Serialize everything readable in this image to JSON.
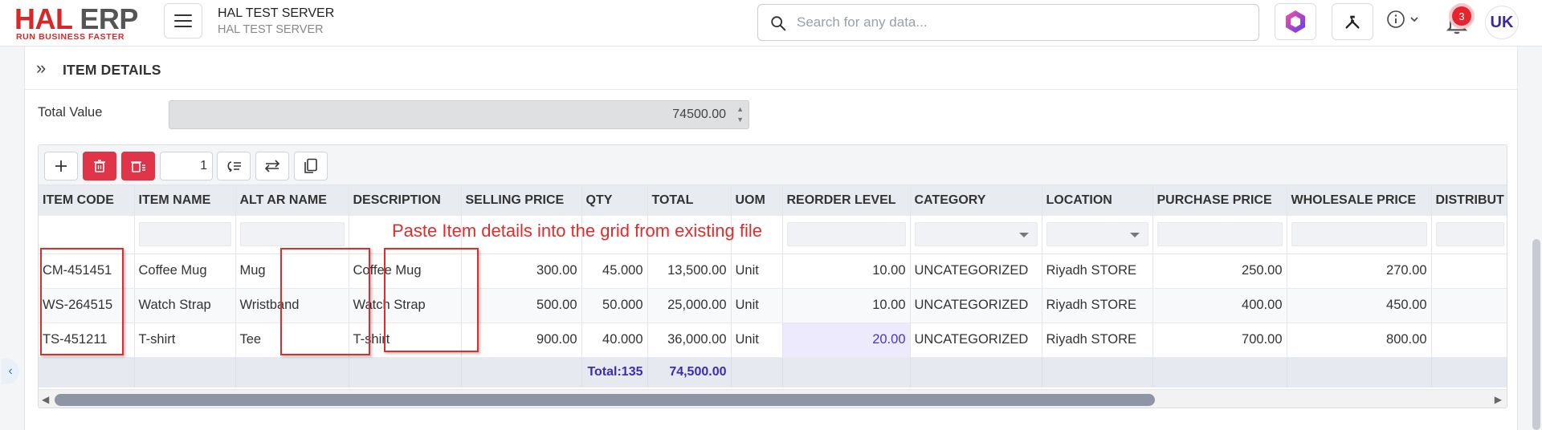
{
  "app": {
    "logo_primary": "HAL",
    "logo_secondary": "ERP",
    "logo_tagline": "RUN BUSINESS FASTER",
    "server_title": "HAL TEST SERVER",
    "server_subtitle": "HAL TEST SERVER",
    "search_placeholder": "Search for any data...",
    "notification_count": "3",
    "avatar_initials": "UK",
    "brand_color": "#d62828",
    "accent_color": "#3d2bb8"
  },
  "section": {
    "title": "ITEM DETAILS",
    "total_value_label": "Total Value",
    "total_value": "74500.00"
  },
  "toolbar": {
    "page_number": "1"
  },
  "grid": {
    "columns": [
      "ITEM CODE",
      "ITEM NAME",
      "ALT AR NAME",
      "DESCRIPTION",
      "SELLING PRICE",
      "QTY",
      "TOTAL",
      "UOM",
      "REORDER LEVEL",
      "CATEGORY",
      "LOCATION",
      "PURCHASE PRICE",
      "WHOLESALE PRICE",
      "DISTRIBUT"
    ],
    "rows": [
      [
        "CM-451451",
        "Coffee Mug",
        "Mug",
        "Coffee Mug",
        "300.00",
        "45.000",
        "13,500.00",
        "Unit",
        "10.00",
        "UNCATEGORIZED",
        "Riyadh STORE",
        "250.00",
        "270.00",
        ""
      ],
      [
        "WS-264515",
        "Watch Strap",
        "Wristband",
        "Watch Strap",
        "500.00",
        "50.000",
        "25,000.00",
        "Unit",
        "10.00",
        "UNCATEGORIZED",
        "Riyadh STORE",
        "400.00",
        "450.00",
        ""
      ],
      [
        "TS-451211",
        "T-shirt",
        "Tee",
        "T-shirt",
        "900.00",
        "40.000",
        "36,000.00",
        "Unit",
        "20.00",
        "UNCATEGORIZED",
        "Riyadh STORE",
        "700.00",
        "800.00",
        ""
      ]
    ],
    "footer_qty": "Total:135",
    "footer_total": "74,500.00"
  },
  "annotation": {
    "text": "Paste Item details into the grid from existing file",
    "color": "#e12c2c"
  }
}
